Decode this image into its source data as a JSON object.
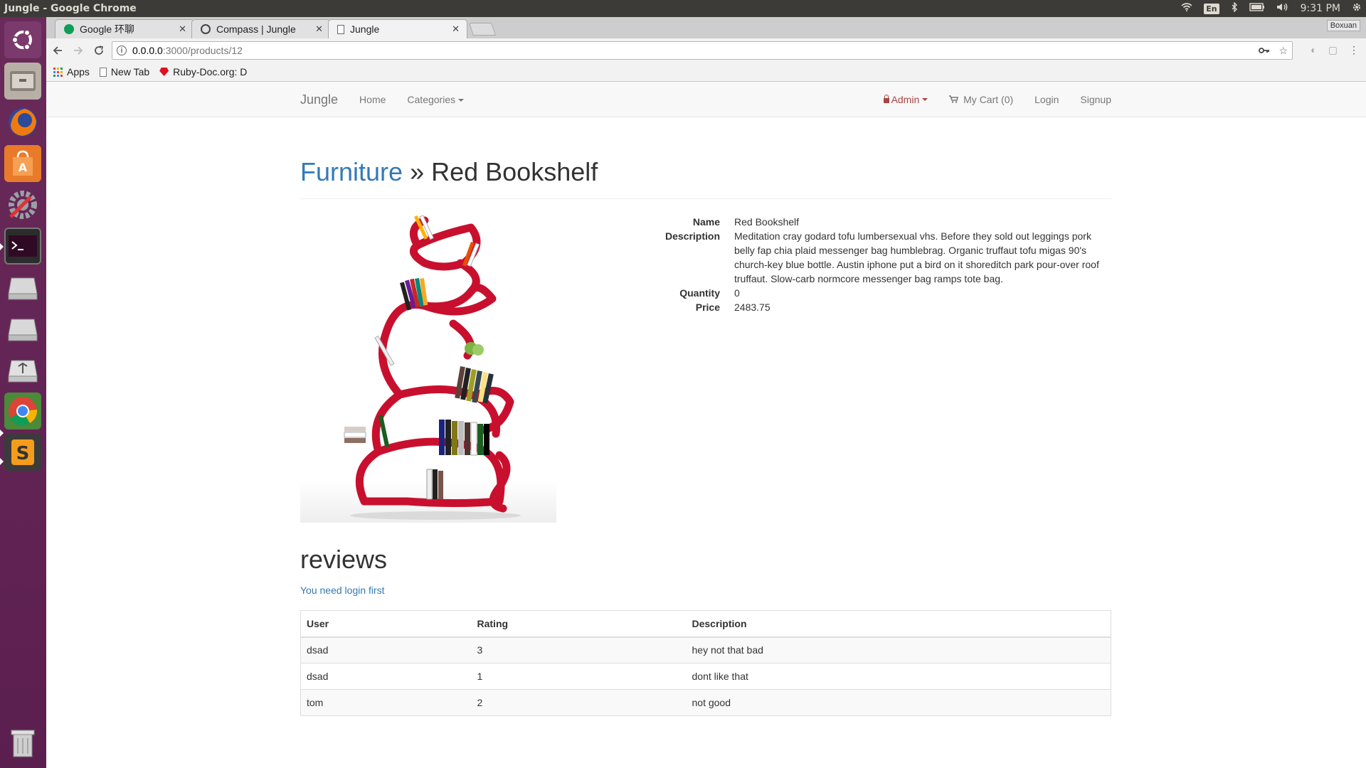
{
  "os": {
    "window_title": "Jungle - Google Chrome",
    "lang": "En",
    "clock": "9:31 PM",
    "launcher_icons": [
      "ubuntu-dash-icon",
      "files-icon",
      "firefox-icon",
      "software-center-icon",
      "system-settings-icon",
      "terminal-icon",
      "drive-icon",
      "drive-icon",
      "usb-drive-icon",
      "chrome-icon",
      "sublime-text-icon",
      "trash-icon"
    ]
  },
  "browser": {
    "profile": "Boxuan",
    "tabs": [
      {
        "label": "Google 环聊",
        "active": false
      },
      {
        "label": "Compass | Jungle",
        "active": false
      },
      {
        "label": "Jungle",
        "active": true
      }
    ],
    "url_host": "0.0.0.0",
    "url_path": ":3000/products/12",
    "bookmarks": [
      "Apps",
      "New Tab",
      "Ruby-Doc.org: D"
    ]
  },
  "navbar": {
    "brand": "Jungle",
    "home": "Home",
    "categories": "Categories",
    "admin": "Admin",
    "cart": "My Cart (0)",
    "login": "Login",
    "signup": "Signup"
  },
  "product": {
    "category": "Furniture",
    "separator": " » ",
    "name": "Red Bookshelf",
    "labels": {
      "name": "Name",
      "description": "Description",
      "quantity": "Quantity",
      "price": "Price"
    },
    "description": "Meditation cray godard tofu lumbersexual vhs. Before they sold out leggings pork belly fap chia plaid messenger bag humblebrag. Organic truffaut tofu migas 90's church-key blue bottle. Austin iphone put a bird on it shoreditch park pour-over roof truffaut. Slow-carb normcore messenger bag ramps tote bag.",
    "quantity": "0",
    "price": "2483.75"
  },
  "reviews": {
    "title": "reviews",
    "login_note": "You need login first",
    "columns": [
      "User",
      "Rating",
      "Description"
    ],
    "rows": [
      {
        "user": "dsad",
        "rating": "3",
        "description": "hey not that bad"
      },
      {
        "user": "dsad",
        "rating": "1",
        "description": "dont like that"
      },
      {
        "user": "tom",
        "rating": "2",
        "description": "not good"
      }
    ]
  },
  "colors": {
    "link": "#337ab7",
    "admin": "#a94442",
    "launcher": "#5b1f4f",
    "bookshelf": "#c8102e"
  }
}
